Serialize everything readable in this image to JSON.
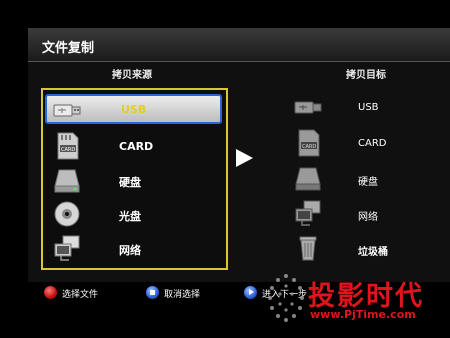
{
  "window": {
    "title": "文件复制"
  },
  "source": {
    "header": "拷贝来源",
    "items": [
      {
        "label": "USB",
        "icon": "usb-drive-icon",
        "selected": true
      },
      {
        "label": "CARD",
        "icon": "sd-card-icon",
        "selected": false
      },
      {
        "label": "硬盘",
        "icon": "hard-disk-icon",
        "selected": false
      },
      {
        "label": "光盘",
        "icon": "optical-disc-icon",
        "selected": false
      },
      {
        "label": "网络",
        "icon": "network-icon",
        "selected": false
      }
    ]
  },
  "destination": {
    "header": "拷贝目标",
    "items": [
      {
        "label": "USB",
        "icon": "usb-drive-icon"
      },
      {
        "label": "CARD",
        "icon": "sd-card-icon"
      },
      {
        "label": "硬盘",
        "icon": "hard-disk-icon"
      },
      {
        "label": "网络",
        "icon": "network-icon"
      },
      {
        "label": "垃圾桶",
        "icon": "trash-bin-icon"
      }
    ]
  },
  "footer": {
    "hints": [
      {
        "label": "选择文件",
        "icon": "red-button-icon",
        "color": "#e21b1b"
      },
      {
        "label": "取消选择",
        "icon": "blue-stop-button-icon",
        "color": "#2a5fd6"
      },
      {
        "label": "进入下一步",
        "icon": "play-button-icon",
        "color": "#2a5fd6"
      }
    ]
  },
  "watermark": {
    "text": "投影时代",
    "url": "www.PjTime.com"
  },
  "colors": {
    "selection_border": "#2b64d8",
    "source_frame": "#d8c636",
    "selected_text": "#e3cf1e",
    "watermark": "#e0141c"
  }
}
